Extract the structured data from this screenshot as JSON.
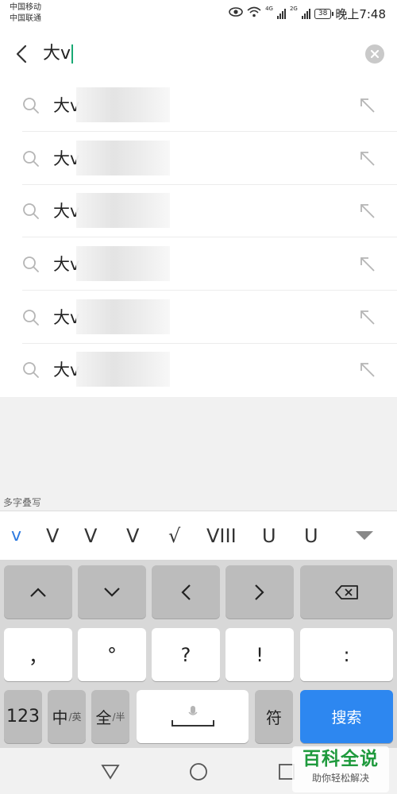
{
  "status_bar": {
    "carrier_1": "中国移动",
    "carrier_2": "中国联通",
    "network_1": "4G",
    "network_2": "2G",
    "battery": "38",
    "time": "晚上7:48",
    "icons": [
      "eye-icon",
      "wifi-icon",
      "signal-icon",
      "signal-icon",
      "battery-icon"
    ]
  },
  "search": {
    "query": "大v",
    "icons": [
      "back-icon",
      "clear-icon"
    ]
  },
  "suggestions": [
    {
      "prefix": "大v"
    },
    {
      "prefix": "大v"
    },
    {
      "prefix": "大v"
    },
    {
      "prefix": "大v"
    },
    {
      "prefix": "大v"
    },
    {
      "prefix": "大v"
    }
  ],
  "ime": {
    "mode_label": "多字叠写",
    "candidates": [
      "v",
      "V",
      "V",
      "V",
      "√",
      "VIII",
      "U",
      "U"
    ],
    "keys": {
      "row2": [
        "，",
        "°",
        "?",
        "!",
        ":"
      ],
      "num": "123",
      "lang_main": "中",
      "lang_sub": "/英",
      "width_main": "全",
      "width_sub": "/半",
      "symbol": "符",
      "search": "搜索"
    }
  },
  "watermark": {
    "title": "百科全说",
    "subtitle": "助你轻松解决"
  },
  "colors": {
    "accent_blue": "#2d87f0",
    "caret_green": "#19a974",
    "watermark_green": "#1f9a3d"
  }
}
